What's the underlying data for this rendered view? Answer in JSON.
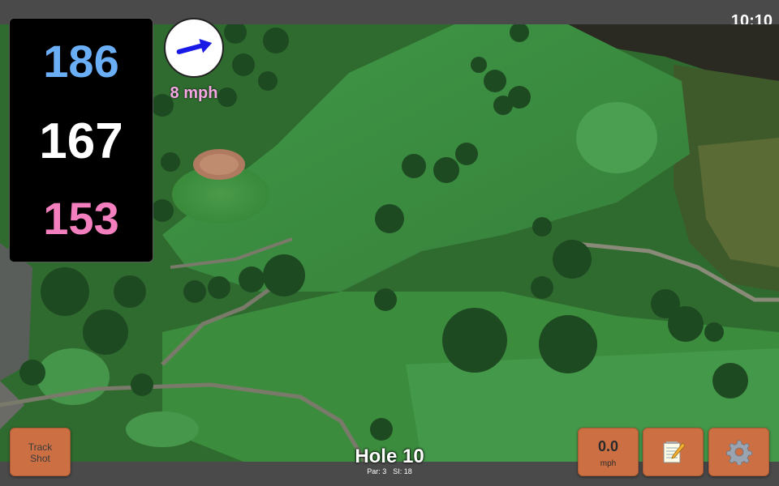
{
  "status_bar": {
    "time": "10:10"
  },
  "distances": {
    "back": "186",
    "middle": "167",
    "front": "153"
  },
  "wind": {
    "speed_label": "8 mph",
    "direction_deg": -15,
    "arrow_color": "#1a1ae6"
  },
  "hole": {
    "title": "Hole 10",
    "par_label": "Par: 3",
    "si_label": "SI: 18"
  },
  "buttons": {
    "track_shot_line1": "Track",
    "track_shot_line2": "Shot",
    "speed_value": "0.0",
    "speed_unit": "mph",
    "notes_icon": "notepad-pencil-icon",
    "settings_icon": "gear-icon"
  },
  "colors": {
    "back_distance": "#6aaef5",
    "middle_distance": "#ffffff",
    "front_distance": "#f47fbf",
    "button_fill": "#cc7044",
    "wind_label": "#f6a8e4"
  }
}
